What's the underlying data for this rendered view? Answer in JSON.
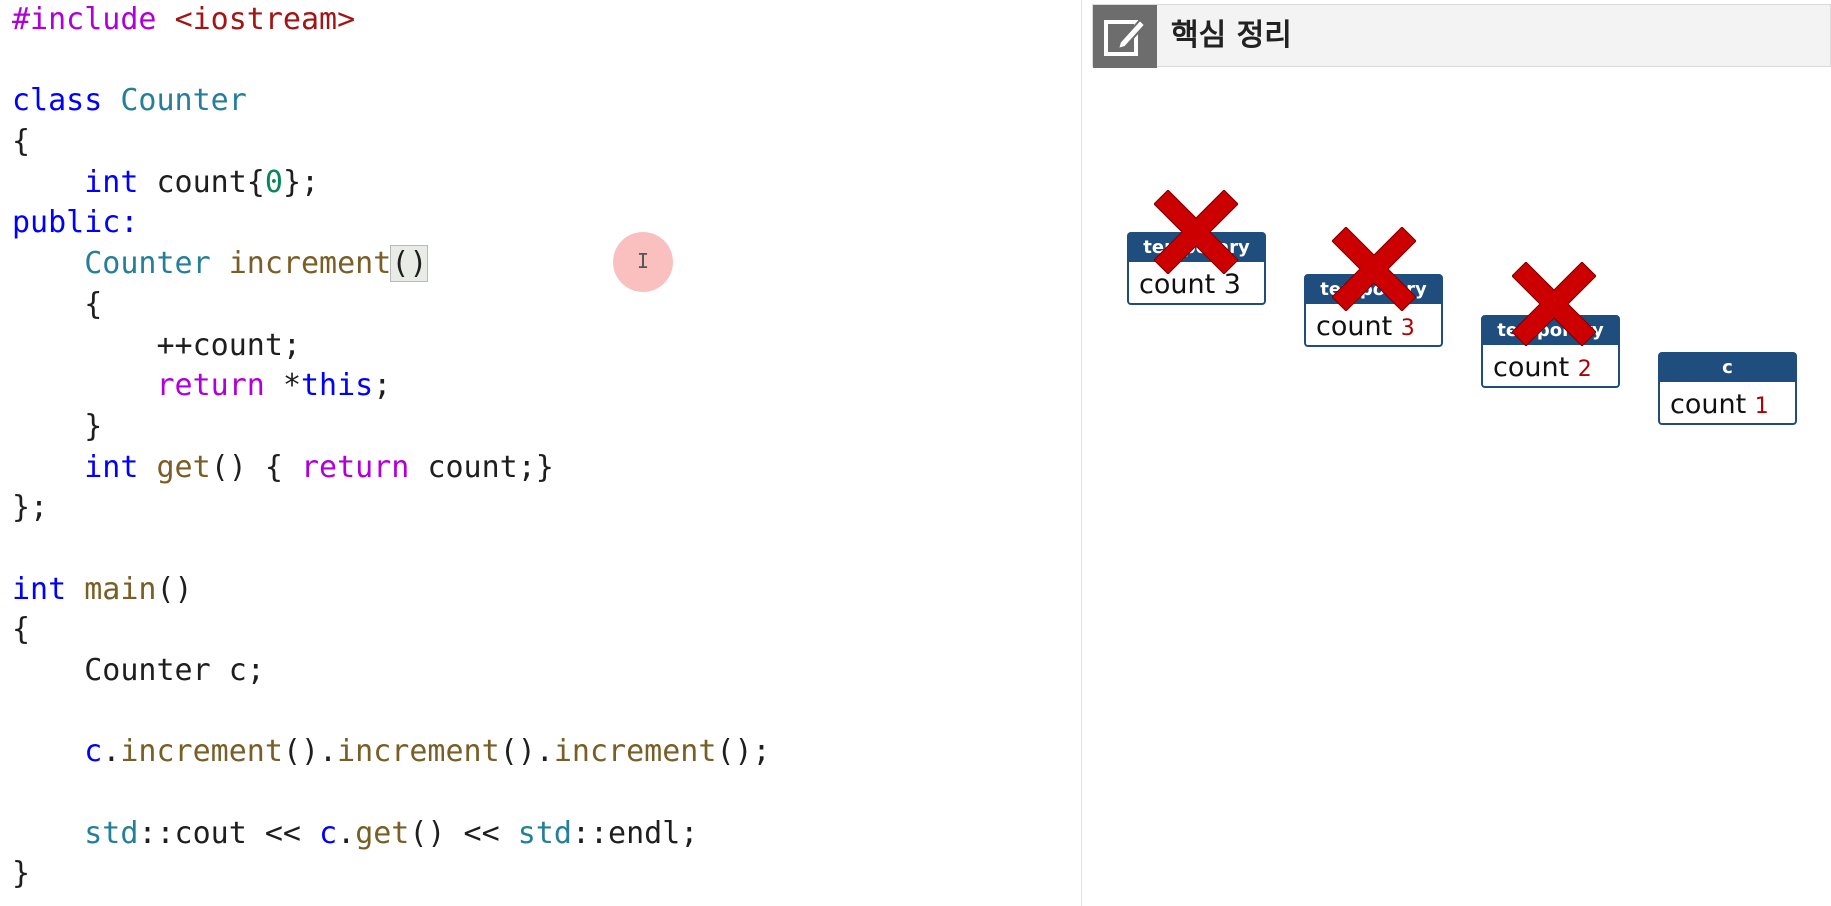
{
  "editor": {
    "lines": [
      [
        {
          "t": "#include ",
          "c": "pp"
        },
        {
          "t": "<iostream>",
          "c": "str"
        }
      ],
      [],
      [
        {
          "t": "class ",
          "c": "kw"
        },
        {
          "t": "Counter",
          "c": "type"
        }
      ],
      [
        {
          "t": "{",
          "c": "plain"
        }
      ],
      [
        {
          "t": "    ",
          "c": "plain"
        },
        {
          "t": "int ",
          "c": "kw"
        },
        {
          "t": "count{",
          "c": "plain"
        },
        {
          "t": "0",
          "c": "num"
        },
        {
          "t": "};",
          "c": "plain"
        }
      ],
      [
        {
          "t": "public:",
          "c": "kw"
        }
      ],
      [
        {
          "t": "    ",
          "c": "plain"
        },
        {
          "t": "Counter ",
          "c": "type"
        },
        {
          "t": "increment",
          "c": "fn"
        },
        {
          "t": "()",
          "c": "bracket"
        }
      ],
      [
        {
          "t": "    {",
          "c": "plain"
        }
      ],
      [
        {
          "t": "        ++count;",
          "c": "plain"
        }
      ],
      [
        {
          "t": "        ",
          "c": "plain"
        },
        {
          "t": "return ",
          "c": "ctrl"
        },
        {
          "t": "*",
          "c": "plain"
        },
        {
          "t": "this",
          "c": "kw"
        },
        {
          "t": ";",
          "c": "plain"
        }
      ],
      [
        {
          "t": "    }",
          "c": "plain"
        }
      ],
      [
        {
          "t": "    ",
          "c": "plain"
        },
        {
          "t": "int ",
          "c": "kw"
        },
        {
          "t": "get",
          "c": "fn"
        },
        {
          "t": "() { ",
          "c": "plain"
        },
        {
          "t": "return ",
          "c": "ctrl"
        },
        {
          "t": "count;}",
          "c": "plain"
        }
      ],
      [
        {
          "t": "};",
          "c": "plain"
        }
      ],
      [],
      [
        {
          "t": "int ",
          "c": "kw"
        },
        {
          "t": "main",
          "c": "fn"
        },
        {
          "t": "()",
          "c": "plain"
        }
      ],
      [
        {
          "t": "{",
          "c": "plain"
        }
      ],
      [
        {
          "t": "    Counter c;",
          "c": "plain"
        }
      ],
      [],
      [
        {
          "t": "    ",
          "c": "plain"
        },
        {
          "t": "c",
          "c": "kw"
        },
        {
          "t": ".",
          "c": "plain"
        },
        {
          "t": "increment",
          "c": "fn"
        },
        {
          "t": "().",
          "c": "plain"
        },
        {
          "t": "increment",
          "c": "fn"
        },
        {
          "t": "().",
          "c": "plain"
        },
        {
          "t": "increment",
          "c": "fn"
        },
        {
          "t": "();",
          "c": "plain"
        }
      ],
      [],
      [
        {
          "t": "    ",
          "c": "plain"
        },
        {
          "t": "std",
          "c": "type"
        },
        {
          "t": "::cout << ",
          "c": "plain"
        },
        {
          "t": "c",
          "c": "kw"
        },
        {
          "t": ".",
          "c": "plain"
        },
        {
          "t": "get",
          "c": "fn"
        },
        {
          "t": "() << ",
          "c": "plain"
        },
        {
          "t": "std",
          "c": "type"
        },
        {
          "t": "::endl;",
          "c": "plain"
        }
      ],
      [
        {
          "t": "}",
          "c": "plain"
        }
      ]
    ]
  },
  "panel": {
    "title": "핵심 정리",
    "icon": "edit-note-icon",
    "objects": [
      {
        "header": "temporary",
        "label": "count",
        "value": "3",
        "crossed": true
      },
      {
        "header": "temporary",
        "label": "count",
        "value": "3",
        "crossed": true
      },
      {
        "header": "temporary",
        "label": "count",
        "value": "2",
        "crossed": true
      },
      {
        "header": "c",
        "label": "count",
        "value": "1",
        "crossed": false
      }
    ]
  },
  "colors": {
    "object_border": "#1f4e7e",
    "cross": "#cc0000",
    "cursor_marker": "#f47272"
  }
}
